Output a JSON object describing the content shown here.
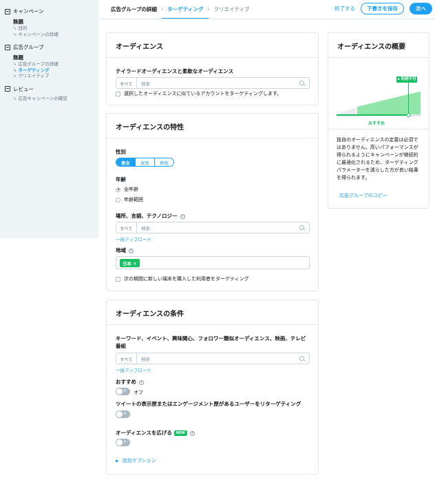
{
  "sidebar": {
    "sections": [
      {
        "title": "キャンペーン",
        "sub": "無題",
        "items": [
          "目的",
          "キャンペーンの詳細"
        ]
      },
      {
        "title": "広告グループ",
        "sub": "無題",
        "items": [
          "広告グループの詳細",
          "ターゲティング",
          "クリエイティブ"
        ]
      },
      {
        "title": "レビュー",
        "sub": "",
        "items": [
          "広告キャンペーンの確認"
        ]
      }
    ]
  },
  "tabs": {
    "details": "広告グループの詳細",
    "targeting": "ターゲティング",
    "creative": "クリエイティブ"
  },
  "actions": {
    "finish": "終了する",
    "save_draft": "下書きを保存",
    "next": "次へ"
  },
  "audience": {
    "title": "オーディエンス",
    "label": "テイラードオーディエンスと柔軟なオーディエンス",
    "search_prefix": "すべて",
    "search_placeholder": "検索",
    "lookalike_label": "選択したオーディエンスに似ているアカウントをターゲティングします。"
  },
  "features": {
    "title": "オーディエンスの特性",
    "gender_label": "性別",
    "gender_options": [
      "男女",
      "女性",
      "男性"
    ],
    "age_label": "年齢",
    "age_options": [
      "全年齢",
      "年齢範囲"
    ],
    "location_label": "場所、言語、テクノロジー",
    "location_prefix": "すべて",
    "location_placeholder": "検索",
    "bulk_upload": "一括アップロード",
    "region_label": "地域",
    "region_tag": "日本 ✕",
    "new_device_label": "次の期間に新しい端末を購入した利用者をターゲティング"
  },
  "conditions": {
    "title": "オーディエンスの条件",
    "keyword_label": "キーワード、イベント、興味関心、フォロワー類似オーディエンス、映画、テレビ番組",
    "search_prefix": "すべて",
    "search_placeholder": "検索",
    "bulk_upload": "一括アップロード",
    "recommended_label": "おすすめ",
    "recommended_value": "オフ",
    "retarget_label": "ツイートの表示歴またはエンゲージメント歴があるユーザーをリターゲティング",
    "expand_label": "オーディエンスを広げる",
    "new_badge": "NEW",
    "more_options": "追加オプション"
  },
  "summary": {
    "title": "オーディエンスの概要",
    "gauge_label": "利用不可",
    "recommended_tag": "おすすめ",
    "description": "独自のオーディエンスの定義は必須ではありません。高いパフォーマンスが得られるようにキャンペーンが継続的に最適化されるため、ターゲティングパラメーターを減らした方が良い結果を得られます。",
    "copy_link": "広告グループのコピー"
  },
  "colors": {
    "accent": "#1da1f2",
    "green": "#17bf63",
    "light_green": "#90e6a8"
  }
}
